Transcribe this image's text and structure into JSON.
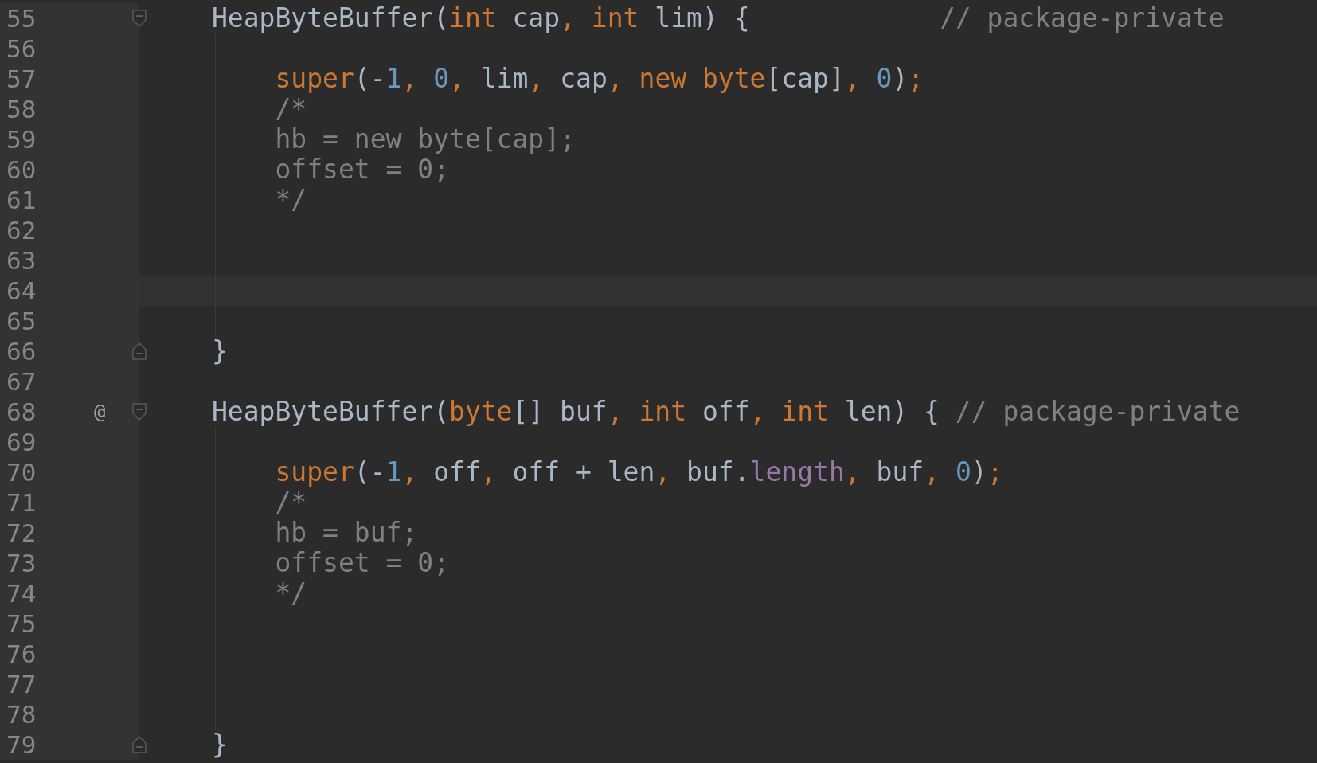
{
  "editor": {
    "lines": [
      {
        "number": "55",
        "current": false,
        "kind": "block-start",
        "tokens": [
          {
            "kind": "plain",
            "text": "HeapByteBuffer("
          },
          {
            "kind": "keyword",
            "text": "int"
          },
          {
            "kind": "plain",
            "text": " cap"
          },
          {
            "kind": "keyword",
            "text": ", int"
          },
          {
            "kind": "plain",
            "text": " lim) {"
          },
          {
            "kind": "comment",
            "text": "            // package-private"
          }
        ],
        "children": [
          {
            "number": "56",
            "current": false,
            "kind": "code"
          },
          {
            "number": "57",
            "current": false,
            "kind": "code",
            "tokens": [
              {
                "kind": "keyword",
                "text": "super"
              },
              {
                "kind": "plain",
                "text": "(-"
              },
              {
                "kind": "number",
                "text": "1"
              },
              {
                "kind": "keyword",
                "text": ", "
              },
              {
                "kind": "number",
                "text": "0"
              },
              {
                "kind": "keyword",
                "text": ", "
              },
              {
                "kind": "plain",
                "text": "lim"
              },
              {
                "kind": "keyword",
                "text": ", "
              },
              {
                "kind": "plain",
                "text": "cap"
              },
              {
                "kind": "keyword",
                "text": ", new byte"
              },
              {
                "kind": "plain",
                "text": "[cap]"
              },
              {
                "kind": "keyword",
                "text": ", "
              },
              {
                "kind": "number",
                "text": "0"
              },
              {
                "kind": "plain",
                "text": ")"
              },
              {
                "kind": "keyword",
                "text": ";"
              }
            ]
          },
          {
            "number": "58",
            "current": false,
            "kind": "code",
            "tokens": [
              {
                "kind": "comment",
                "text": "/*"
              }
            ]
          },
          {
            "number": "59",
            "current": false,
            "kind": "code",
            "tokens": [
              {
                "kind": "comment",
                "text": "hb = new byte[cap];"
              }
            ]
          },
          {
            "number": "60",
            "current": false,
            "kind": "code",
            "tokens": [
              {
                "kind": "comment",
                "text": "offset = 0;"
              }
            ]
          },
          {
            "number": "61",
            "current": false,
            "kind": "code",
            "tokens": [
              {
                "kind": "comment",
                "text": "*/"
              }
            ]
          },
          {
            "number": "62",
            "current": false,
            "kind": "code"
          },
          {
            "number": "63",
            "current": false,
            "kind": "code"
          },
          {
            "number": "64",
            "current": true,
            "kind": "code"
          },
          {
            "number": "65",
            "current": false,
            "kind": "code"
          }
        ]
      },
      {
        "number": "66",
        "current": false,
        "kind": "block-end",
        "tokens": [
          {
            "kind": "plain",
            "text": "}"
          }
        ]
      },
      {
        "number": "67",
        "current": false,
        "kind": "code"
      },
      {
        "number": "68",
        "current": false,
        "kind": "block-start",
        "gutter_mark": "@",
        "tokens": [
          {
            "kind": "plain",
            "text": "HeapByteBuffer("
          },
          {
            "kind": "keyword",
            "text": "byte"
          },
          {
            "kind": "plain",
            "text": "[] buf"
          },
          {
            "kind": "keyword",
            "text": ", int"
          },
          {
            "kind": "plain",
            "text": " off"
          },
          {
            "kind": "keyword",
            "text": ", int"
          },
          {
            "kind": "plain",
            "text": " len) { "
          },
          {
            "kind": "comment",
            "text": "// package-private"
          }
        ],
        "children": [
          {
            "number": "69",
            "current": false,
            "kind": "code"
          },
          {
            "number": "70",
            "current": false,
            "kind": "code",
            "tokens": [
              {
                "kind": "keyword",
                "text": "super"
              },
              {
                "kind": "plain",
                "text": "(-"
              },
              {
                "kind": "number",
                "text": "1"
              },
              {
                "kind": "keyword",
                "text": ", "
              },
              {
                "kind": "plain",
                "text": "off"
              },
              {
                "kind": "keyword",
                "text": ", "
              },
              {
                "kind": "plain",
                "text": "off + len"
              },
              {
                "kind": "keyword",
                "text": ", "
              },
              {
                "kind": "plain",
                "text": "buf."
              },
              {
                "kind": "field",
                "text": "length"
              },
              {
                "kind": "keyword",
                "text": ", "
              },
              {
                "kind": "plain",
                "text": "buf"
              },
              {
                "kind": "keyword",
                "text": ", "
              },
              {
                "kind": "number",
                "text": "0"
              },
              {
                "kind": "plain",
                "text": ")"
              },
              {
                "kind": "keyword",
                "text": ";"
              }
            ]
          },
          {
            "number": "71",
            "current": false,
            "kind": "code",
            "tokens": [
              {
                "kind": "comment",
                "text": "/*"
              }
            ]
          },
          {
            "number": "72",
            "current": false,
            "kind": "code",
            "tokens": [
              {
                "kind": "comment",
                "text": "hb = buf;"
              }
            ]
          },
          {
            "number": "73",
            "current": false,
            "kind": "code",
            "tokens": [
              {
                "kind": "comment",
                "text": "offset = 0;"
              }
            ]
          },
          {
            "number": "74",
            "current": false,
            "kind": "code",
            "tokens": [
              {
                "kind": "comment",
                "text": "*/"
              }
            ]
          },
          {
            "number": "75",
            "current": false,
            "kind": "code"
          },
          {
            "number": "76",
            "current": false,
            "kind": "code"
          },
          {
            "number": "77",
            "current": false,
            "kind": "code"
          },
          {
            "number": "78",
            "current": false,
            "kind": "code"
          }
        ]
      },
      {
        "number": "79",
        "current": false,
        "kind": "block-end",
        "tokens": [
          {
            "kind": "plain",
            "text": "}"
          }
        ]
      }
    ]
  }
}
